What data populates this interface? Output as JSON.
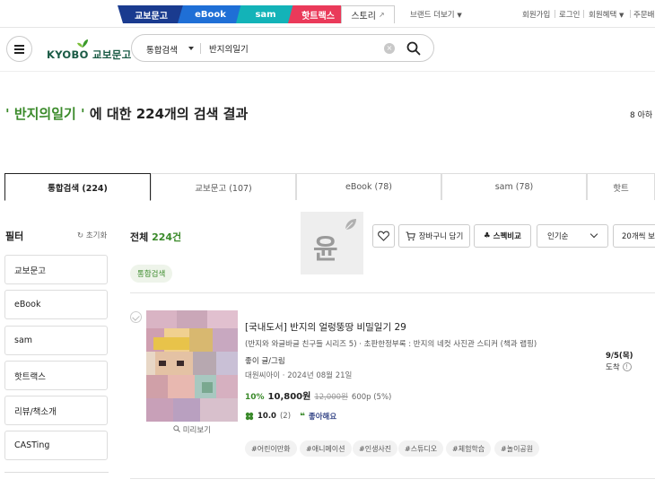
{
  "brand_tabs": [
    {
      "label": "교보문고"
    },
    {
      "label": "eBook"
    },
    {
      "label": "sam"
    },
    {
      "label": "핫트랙스"
    },
    {
      "label": "스토리"
    }
  ],
  "top_links": {
    "brand_more": "브랜드 더보기",
    "join": "회원가입",
    "login": "로그인",
    "benefits": "회원혜택",
    "orders": "주문배"
  },
  "header": {
    "logo_text": "KYOBO 교보문고",
    "search_category": "통합검색",
    "search_value": "반지의일기",
    "clear_symbol": "×"
  },
  "result_header": {
    "keyword": "' 반지의일기 '",
    "suffix": "에 대한 224개의 검색 결과",
    "right_text": "8  아하"
  },
  "tabs": [
    {
      "label": "통합검색 (224)",
      "active": true
    },
    {
      "label": "교보문고 (107)"
    },
    {
      "label": "eBook (78)"
    },
    {
      "label": "sam (78)"
    },
    {
      "label": "핫트"
    }
  ],
  "filter": {
    "title": "필터",
    "reset": "초기화",
    "items": [
      "교보문고",
      "eBook",
      "sam",
      "핫트랙스",
      "리뷰/책소개",
      "CASTing"
    ]
  },
  "results": {
    "total_label": "전체",
    "total_count": "224건",
    "watermark_text": "윤",
    "cart_label": "장바구니 담기",
    "compare_label": "스펙비교",
    "sort_label": "인기순",
    "per_page_label": "20개씩 보",
    "chip_label": "통합검색"
  },
  "product": {
    "title": "[국내도서] 반지의 얼렁뚱땅 비밀일기 29",
    "subtitle": "(반지와 와글바글 친구들 시리즈 5) · 초판한정부록 : 반지의 네컷 사진관 스티커 (책과 랩핑)",
    "author": "좋이 글/그림",
    "publisher": "대원씨아이 · 2024년 08월 21일",
    "discount": "10%",
    "price": "10,800원",
    "original_price": "12,000원",
    "points": "600p (5%)",
    "rating": "10.0",
    "review_count": "(2)",
    "like_label": "좋아해요",
    "preview_label": "미리보기",
    "delivery_date": "9/5(목)",
    "delivery_label": "도착",
    "tags": [
      "#어린이만화",
      "#애니메이션",
      "#인생사진",
      "#스튜디오",
      "#체험학습",
      "#놀이공원"
    ]
  },
  "colors": {
    "brand_green": "#3a8a2a",
    "kyobo_navy": "#1a3b8f",
    "ebook_blue": "#1f6fd6",
    "sam_teal": "#13b3b8",
    "hottracks_pink": "#ea3a5a"
  }
}
